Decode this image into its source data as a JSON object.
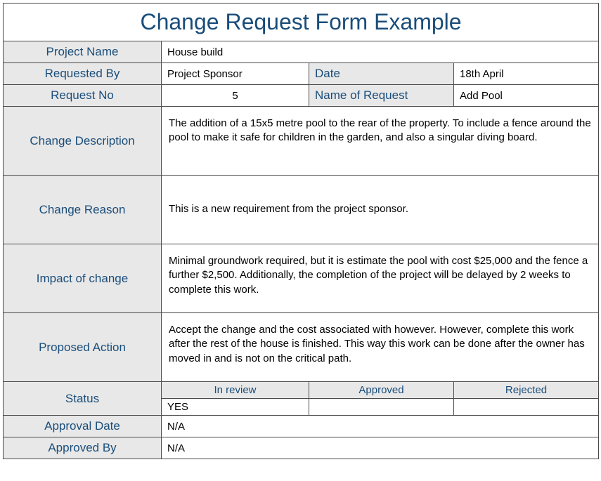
{
  "title": "Change Request Form Example",
  "labels": {
    "projectName": "Project Name",
    "requestedBy": "Requested By",
    "date": "Date",
    "requestNo": "Request No",
    "nameOfRequest": "Name of Request",
    "changeDescription": "Change Description",
    "changeReason": "Change Reason",
    "impactOfChange": "Impact of change",
    "proposedAction": "Proposed Action",
    "status": "Status",
    "approvalDate": "Approval Date",
    "approvedBy": "Approved By"
  },
  "fields": {
    "projectName": "House build",
    "requestedBy": "Project Sponsor",
    "date": "18th April",
    "requestNo": "5",
    "nameOfRequest": "Add Pool",
    "changeDescription": "The addition of a 15x5 metre pool to the rear of the property. To include a fence around the pool to make it safe for children in the garden, and also a singular diving board.",
    "changeReason": "This is a new requirement from the project sponsor.",
    "impactOfChange": "Minimal groundwork required, but it is estimate the pool with cost $25,000 and the fence a further $2,500. Additionally, the completion of the project will be delayed by 2 weeks to complete this work.",
    "proposedAction": "Accept the change and the cost associated with however. However, complete this work after the rest of the house is finished. This way this work can be done after the owner has moved in and is not on the critical path.",
    "approvalDate": "N/A",
    "approvedBy": "N/A"
  },
  "status": {
    "headers": {
      "inReview": "In review",
      "approved": "Approved",
      "rejected": "Rejected"
    },
    "values": {
      "inReview": "YES",
      "approved": "",
      "rejected": ""
    }
  }
}
